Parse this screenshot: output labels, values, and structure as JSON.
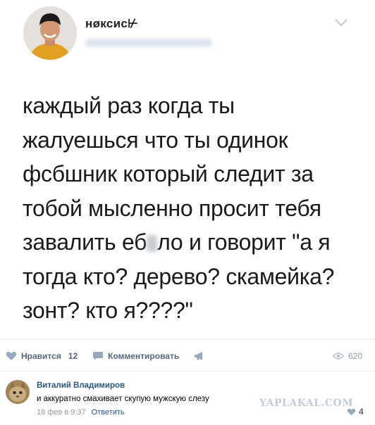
{
  "tweet": {
    "username": "нøксис⊬",
    "text_lines": [
      "каждый раз когда ты",
      "жалуешься что ты одинок",
      "фсбшник который следит за",
      "тобой мысленно просит тебя",
      "завалить еб",
      "ло и говорит \"а я",
      "тогда кто? дерево? скамейка?",
      "зонт? кто я????\""
    ]
  },
  "actions": {
    "like_label": "Нравится",
    "like_count": "12",
    "comment_label": "Комментировать",
    "views_count": "620"
  },
  "comment": {
    "author": "Виталий Владимиров",
    "text": "и аккуратно смахивает скупую мужскую слезу",
    "date": "18 фев в 9:37",
    "reply_label": "Ответить",
    "likes": "4"
  },
  "watermark": "YAPLAKAL.COM",
  "colors": {
    "link": "#2a5885",
    "action_text": "#55677d",
    "muted": "#939ba5"
  }
}
